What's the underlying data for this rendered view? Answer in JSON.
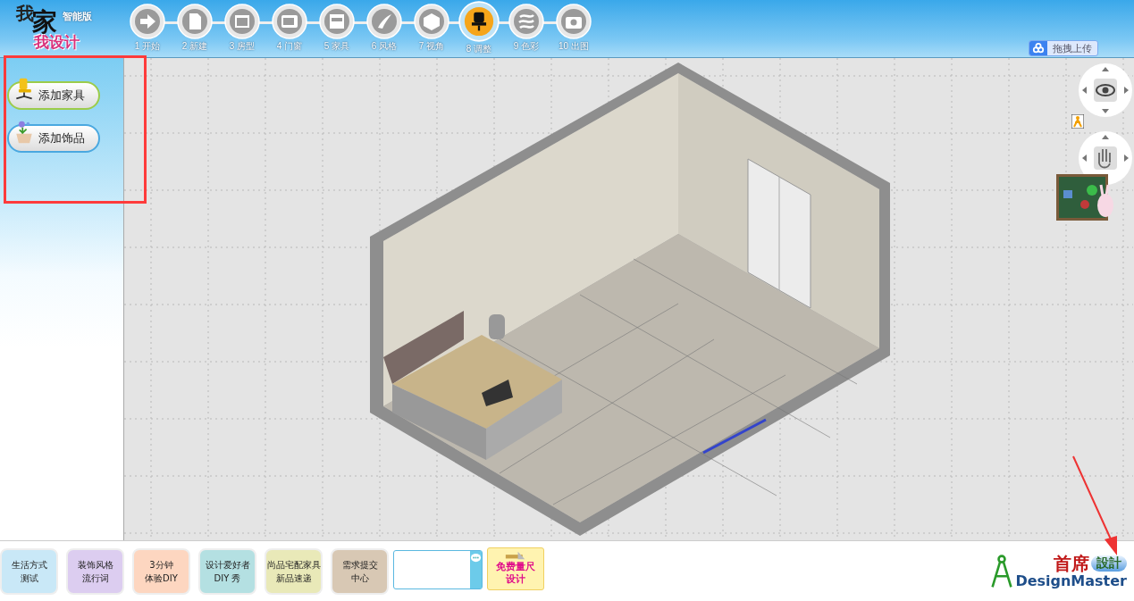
{
  "logo": {
    "title_top": "我",
    "title_big": "家",
    "title_sub": "我设计",
    "edition": "智能版"
  },
  "steps": [
    {
      "label": "1 开始",
      "selected": false
    },
    {
      "label": "2 新建",
      "selected": false
    },
    {
      "label": "3 房型",
      "selected": false
    },
    {
      "label": "4 门窗",
      "selected": false
    },
    {
      "label": "5 家具",
      "selected": false
    },
    {
      "label": "6 风格",
      "selected": false
    },
    {
      "label": "7 视角",
      "selected": false
    },
    {
      "label": "8 调整",
      "selected": true
    },
    {
      "label": "9 色彩",
      "selected": false
    },
    {
      "label": "10 出图",
      "selected": false
    }
  ],
  "upload_button": "拖拽上传",
  "sidebar": {
    "buttons": [
      {
        "label": "添加家具",
        "kind": "furniture"
      },
      {
        "label": "添加饰品",
        "kind": "decor"
      }
    ]
  },
  "bottom_tiles": [
    {
      "lines": [
        "生活方式",
        "测试"
      ],
      "color": "#c9e8f7"
    },
    {
      "lines": [
        "装饰风格",
        "流行词"
      ],
      "color": "#dccdf0"
    },
    {
      "lines": [
        "3分钟",
        "体验DIY"
      ],
      "color": "#fdd6c0"
    },
    {
      "lines": [
        "设计爱好者",
        "DIY 秀"
      ],
      "color": "#b4e0e2"
    },
    {
      "lines": [
        "尚品宅配家具",
        "新品速递"
      ],
      "color": "#e9e9b8"
    },
    {
      "lines": [
        "需求提交",
        "中心"
      ],
      "color": "#d8c8b4"
    }
  ],
  "measure_button": [
    "免费量尺",
    "设计"
  ],
  "brand": {
    "name_cn": "首席",
    "badge": "設計",
    "name_en": "DesignMaster"
  }
}
